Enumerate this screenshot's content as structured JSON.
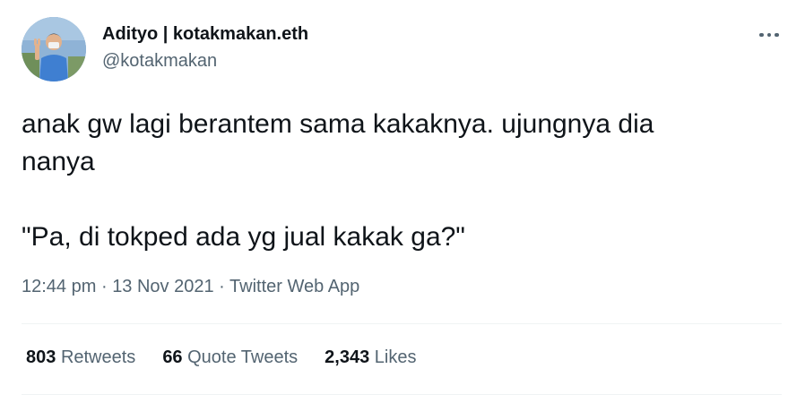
{
  "author": {
    "display_name": "Adityo | kotakmakan.eth",
    "handle": "@kotakmakan"
  },
  "tweet": {
    "lines": [
      "anak gw lagi berantem sama kakaknya. ujungnya dia",
      "nanya",
      "\"Pa, di tokped ada yg jual kakak ga?\""
    ]
  },
  "meta": {
    "time": "12:44 pm",
    "separator": "·",
    "date": "13 Nov 2021",
    "source": "Twitter Web App"
  },
  "stats": [
    {
      "count": "803",
      "label": "Retweets"
    },
    {
      "count": "66",
      "label": "Quote Tweets"
    },
    {
      "count": "2,343",
      "label": "Likes"
    }
  ],
  "icons": {
    "more": "more-horizontal-icon"
  },
  "colors": {
    "text_primary": "#0f1419",
    "text_secondary": "#536471",
    "divider": "#eff3f4"
  }
}
